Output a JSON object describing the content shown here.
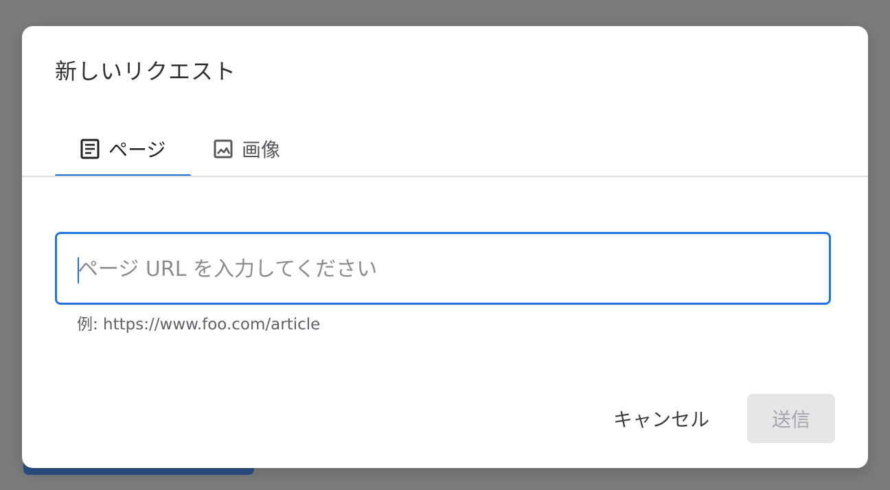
{
  "dialog": {
    "title": "新しいリクエスト"
  },
  "tabs": [
    {
      "label": "ページ",
      "icon": "document-icon",
      "active": true
    },
    {
      "label": "画像",
      "icon": "image-icon",
      "active": false
    }
  ],
  "url_input": {
    "value": "",
    "placeholder": "ページ URL を入力してください",
    "helper": "例: https://www.foo.com/article"
  },
  "actions": {
    "cancel_label": "キャンセル",
    "submit_label": "送信"
  },
  "colors": {
    "accent": "#1f73e1",
    "backdrop": "#7b7c7e",
    "disabled_bg": "#e5e6e8",
    "disabled_text": "#a3a5a9"
  }
}
